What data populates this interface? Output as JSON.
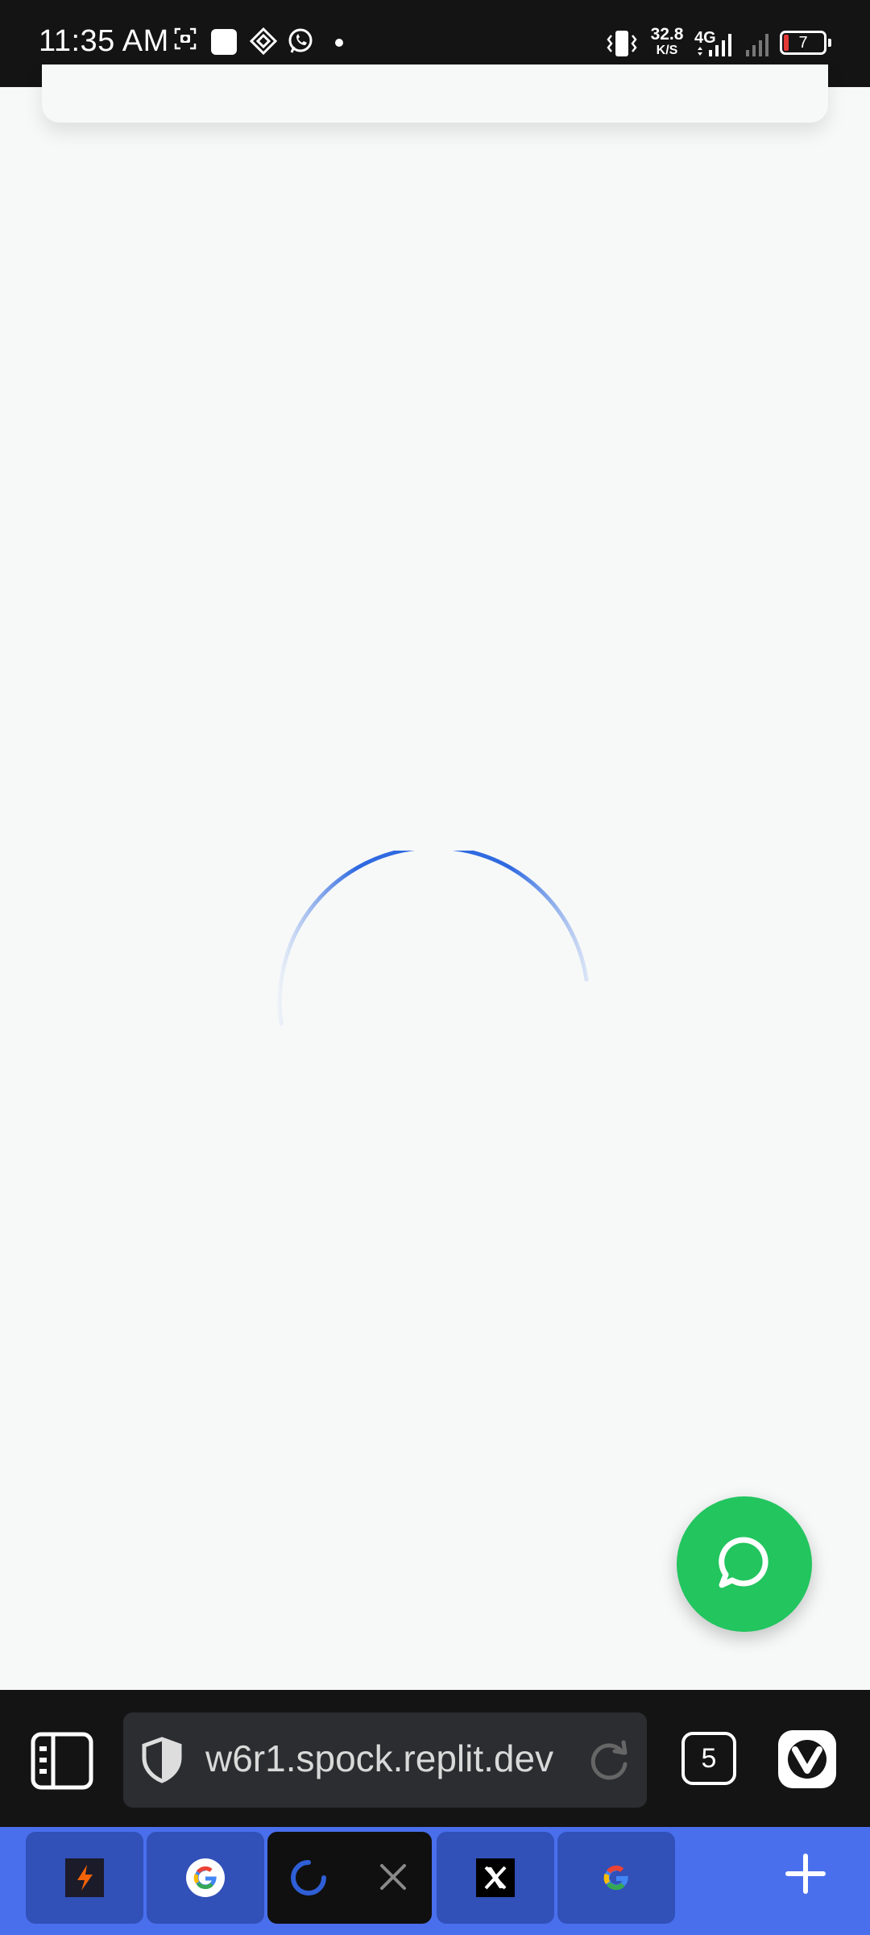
{
  "status_bar": {
    "time": "11:35 AM",
    "net_speed_value": "32.8",
    "net_speed_unit": "K/S",
    "network_type": "4G",
    "battery_level": "7"
  },
  "browser": {
    "url": "w6r1.spock.replit.dev",
    "tab_count": "5"
  },
  "tabs": [
    {
      "icon": "replit-bolt-icon"
    },
    {
      "icon": "google-icon"
    },
    {
      "icon": "loading-spinner-icon",
      "active": true
    },
    {
      "icon": "x-logo-icon"
    },
    {
      "icon": "google-icon"
    }
  ],
  "colors": {
    "background": "#f7f9f9",
    "spinner": "#2f6ae0",
    "chat_fab": "#22c55e",
    "tab_strip": "#4a6fed"
  }
}
